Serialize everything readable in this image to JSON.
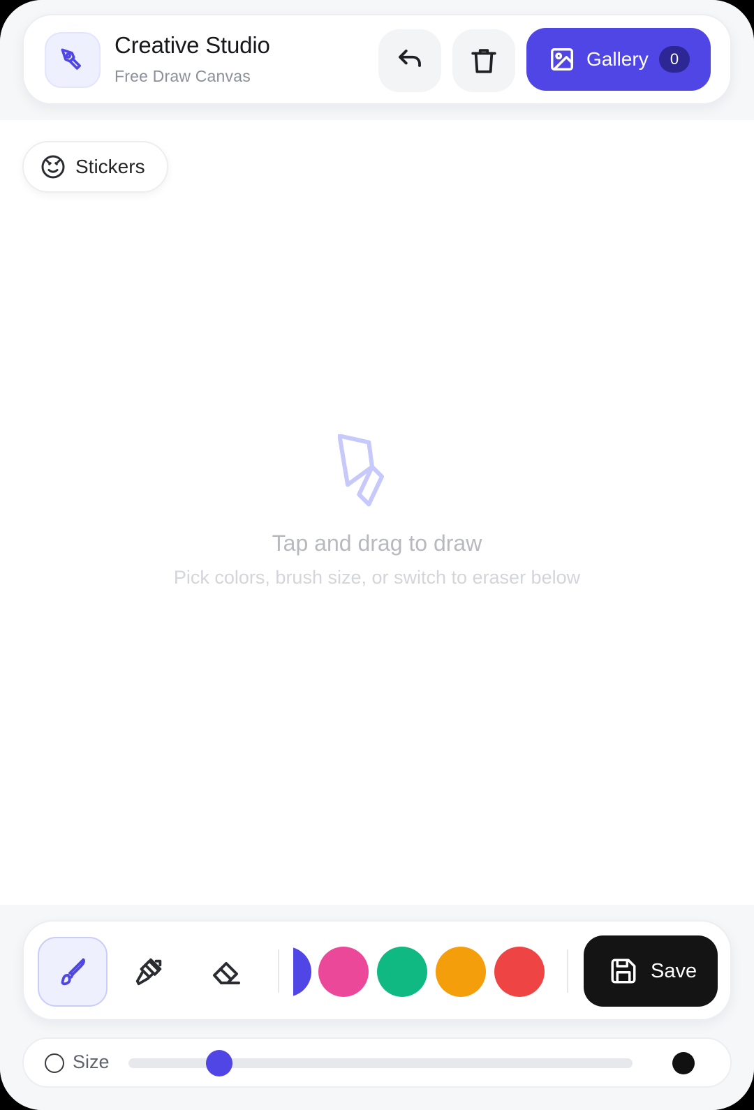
{
  "header": {
    "title": "Creative Studio",
    "subtitle": "Free Draw Canvas",
    "logo_icon": "pen-nib-icon",
    "undo_icon": "undo-icon",
    "delete_icon": "trash-icon",
    "gallery": {
      "label": "Gallery",
      "count": "0",
      "icon": "image-icon",
      "color": "#4f46e5"
    }
  },
  "stickers": {
    "label": "Stickers",
    "icon": "smile-icon"
  },
  "canvas": {
    "empty_title": "Tap and drag to draw",
    "empty_hint": "Pick colors, brush size, or switch to eraser below",
    "empty_icon": "pen-nib-icon"
  },
  "toolbar": {
    "tools": [
      {
        "name": "brush",
        "icon": "brush-icon",
        "active": true
      },
      {
        "name": "marker",
        "icon": "marker-icon",
        "active": false
      },
      {
        "name": "eraser",
        "icon": "eraser-icon",
        "active": false
      }
    ],
    "colors": [
      "#4f46e5",
      "#ec4899",
      "#10b981",
      "#f59e0b",
      "#ef4444",
      "#3b82f6"
    ],
    "save_label": "Save",
    "save_icon": "floppy-disk-icon"
  },
  "size": {
    "label": "Size",
    "value": 0.18
  }
}
